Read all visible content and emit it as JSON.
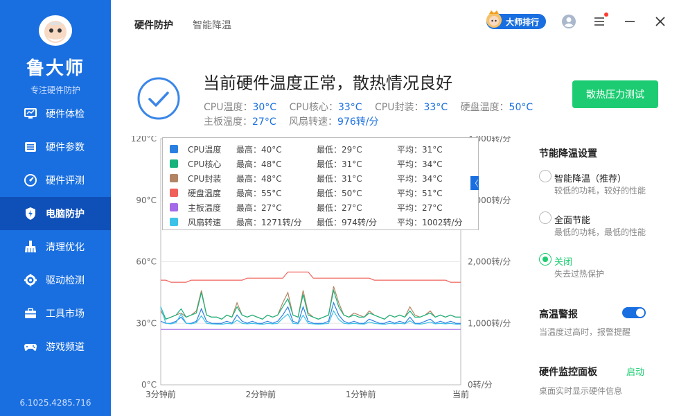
{
  "sidebar": {
    "title": "鲁大师",
    "subtitle": "专注硬件防护",
    "version": "6.1025.4285.716",
    "items": [
      {
        "label": "硬件体检",
        "icon": "monitor-icon"
      },
      {
        "label": "硬件参数",
        "icon": "list-icon"
      },
      {
        "label": "硬件评测",
        "icon": "speedometer-icon"
      },
      {
        "label": "电脑防护",
        "icon": "shield-icon",
        "active": true
      },
      {
        "label": "清理优化",
        "icon": "broom-icon"
      },
      {
        "label": "驱动检测",
        "icon": "gear-icon"
      },
      {
        "label": "工具市场",
        "icon": "toolbox-icon"
      },
      {
        "label": "游戏频道",
        "icon": "gamepad-icon"
      }
    ]
  },
  "header": {
    "tabs": [
      "硬件防护",
      "智能降温"
    ],
    "rank_label": "大师排行"
  },
  "status": {
    "title": "当前硬件温度正常，散热情况良好",
    "line1": [
      {
        "label": "CPU温度：",
        "value": "30°C"
      },
      {
        "label": "CPU核心：",
        "value": "33°C"
      },
      {
        "label": "CPU封装：",
        "value": "33°C"
      },
      {
        "label": "硬盘温度：",
        "value": "50°C"
      }
    ],
    "line2": [
      {
        "label": "主板温度：",
        "value": "27°C"
      },
      {
        "label": "风扇转速：",
        "value": "976转/分"
      }
    ],
    "stress_button": "散热压力测试"
  },
  "legend": {
    "toggle": "〈",
    "rows": [
      {
        "name": "CPU温度",
        "max": "最高：40°C",
        "min": "最低：29°C",
        "avg": "平均：31°C",
        "color": "#2b7fe0"
      },
      {
        "name": "CPU核心",
        "max": "最高：48°C",
        "min": "最低：31°C",
        "avg": "平均：34°C",
        "color": "#16b37a"
      },
      {
        "name": "CPU封装",
        "max": "最高：48°C",
        "min": "最低：31°C",
        "avg": "平均：34°C",
        "color": "#b38463"
      },
      {
        "name": "硬盘温度",
        "max": "最高：55°C",
        "min": "最低：50°C",
        "avg": "平均：51°C",
        "color": "#f0605a"
      },
      {
        "name": "主板温度",
        "max": "最高：27°C",
        "min": "最低：27°C",
        "avg": "平均：27°C",
        "color": "#a46ae8"
      },
      {
        "name": "风扇转速",
        "max": "最高：1271转/分",
        "min": "最低：974转/分",
        "avg": "平均：1002转/分",
        "color": "#3cc2e8"
      }
    ]
  },
  "chart_data": {
    "type": "line",
    "x_tick_labels": [
      "3分钟前",
      "2分钟前",
      "1分钟前",
      "当前"
    ],
    "y_left_ticks": [
      "0°C",
      "30°C",
      "60°C",
      "90°C",
      "120°C"
    ],
    "y_right_ticks": [
      "0转/分",
      "1,000转/分",
      "2,000转/分",
      "3,000转/分",
      "4,000转/分"
    ],
    "y_left_lim": [
      0,
      120
    ],
    "y_right_lim": [
      0,
      4000
    ],
    "x_count": 60,
    "series": [
      {
        "name": "硬盘温度",
        "axis": "left",
        "color": "#f0605a",
        "values": [
          51,
          51,
          50,
          50,
          50,
          50,
          51,
          51,
          51,
          51,
          51,
          51,
          51,
          51,
          51,
          51,
          51,
          52,
          52,
          52,
          52,
          52,
          52,
          52,
          52,
          55,
          55,
          55,
          55,
          55,
          52,
          52,
          52,
          52,
          52,
          52,
          52,
          52,
          52,
          52,
          52,
          52,
          51,
          51,
          51,
          51,
          51,
          51,
          51,
          51,
          51,
          51,
          51,
          51,
          51,
          51,
          51,
          50,
          50,
          50
        ]
      },
      {
        "name": "CPU封装",
        "axis": "left",
        "color": "#b38463",
        "values": [
          36,
          32,
          33,
          34,
          35,
          33,
          34,
          36,
          46,
          34,
          33,
          33,
          32,
          34,
          33,
          40,
          34,
          33,
          34,
          33,
          32,
          34,
          33,
          34,
          40,
          45,
          34,
          33,
          46,
          35,
          33,
          32,
          33,
          34,
          48,
          40,
          34,
          33,
          35,
          34,
          33,
          36,
          34,
          33,
          32,
          34,
          33,
          34,
          33,
          38,
          34,
          33,
          34,
          36,
          33,
          34,
          33,
          34,
          33,
          33
        ]
      },
      {
        "name": "CPU核心",
        "axis": "left",
        "color": "#16b37a",
        "values": [
          38,
          32,
          33,
          34,
          37,
          33,
          34,
          35,
          45,
          34,
          33,
          33,
          32,
          34,
          33,
          38,
          34,
          33,
          34,
          33,
          32,
          34,
          33,
          34,
          38,
          42,
          34,
          33,
          44,
          34,
          33,
          32,
          33,
          34,
          46,
          38,
          34,
          33,
          34,
          33,
          33,
          35,
          34,
          33,
          32,
          34,
          33,
          34,
          33,
          36,
          33,
          33,
          34,
          35,
          33,
          34,
          33,
          34,
          33,
          33
        ]
      },
      {
        "name": "CPU温度",
        "axis": "left",
        "color": "#2b7fe0",
        "values": [
          31,
          30,
          30,
          31,
          33,
          30,
          30,
          31,
          37,
          31,
          30,
          30,
          30,
          31,
          30,
          34,
          31,
          30,
          31,
          30,
          30,
          31,
          30,
          31,
          34,
          38,
          31,
          30,
          38,
          31,
          30,
          30,
          30,
          31,
          40,
          34,
          31,
          30,
          31,
          30,
          30,
          32,
          31,
          30,
          30,
          31,
          30,
          31,
          30,
          33,
          30,
          30,
          31,
          32,
          30,
          31,
          30,
          31,
          30,
          30
        ]
      },
      {
        "name": "主板温度",
        "axis": "left",
        "color": "#a46ae8",
        "values": [
          27,
          27,
          27,
          27,
          27,
          27,
          27,
          27,
          27,
          27,
          27,
          27,
          27,
          27,
          27,
          27,
          27,
          27,
          27,
          27,
          27,
          27,
          27,
          27,
          27,
          27,
          27,
          27,
          27,
          27,
          27,
          27,
          27,
          27,
          27,
          27,
          27,
          27,
          27,
          27,
          27,
          27,
          27,
          27,
          27,
          27,
          27,
          27,
          27,
          27,
          27,
          27,
          27,
          27,
          27,
          27,
          27,
          27,
          27,
          27
        ]
      },
      {
        "name": "风扇转速",
        "axis": "right",
        "color": "#3cc2e8",
        "values": [
          1271,
          1000,
          990,
          1010,
          1150,
          1000,
          990,
          1010,
          1120,
          1000,
          990,
          985,
          980,
          1000,
          990,
          1050,
          1000,
          990,
          1000,
          990,
          980,
          1000,
          990,
          1000,
          1080,
          1150,
          1000,
          990,
          1130,
          1000,
          990,
          980,
          990,
          1000,
          1200,
          1060,
          1000,
          990,
          1000,
          990,
          985,
          1020,
          1000,
          990,
          980,
          1000,
          990,
          1000,
          990,
          1040,
          990,
          985,
          1000,
          1020,
          990,
          1000,
          990,
          1000,
          985,
          976
        ]
      }
    ]
  },
  "panel": {
    "energy_title": "节能降温设置",
    "options": [
      {
        "label": "智能降温（推荐）",
        "desc": "较低的功耗，较好的性能",
        "on": false
      },
      {
        "label": "全面节能",
        "desc": "最低的功耗，最低的性能",
        "on": false
      },
      {
        "label": "关闭",
        "desc": "失去过热保护",
        "on": true
      }
    ],
    "alarm_title": "高温警报",
    "alarm_desc": "当温度过高时，报警提醒",
    "monitor_title": "硬件监控面板",
    "monitor_link": "启动",
    "monitor_desc": "桌面实时显示硬件信息"
  },
  "colors": {
    "brand": "#1a6fe0",
    "accent_green": "#1dcc72"
  }
}
